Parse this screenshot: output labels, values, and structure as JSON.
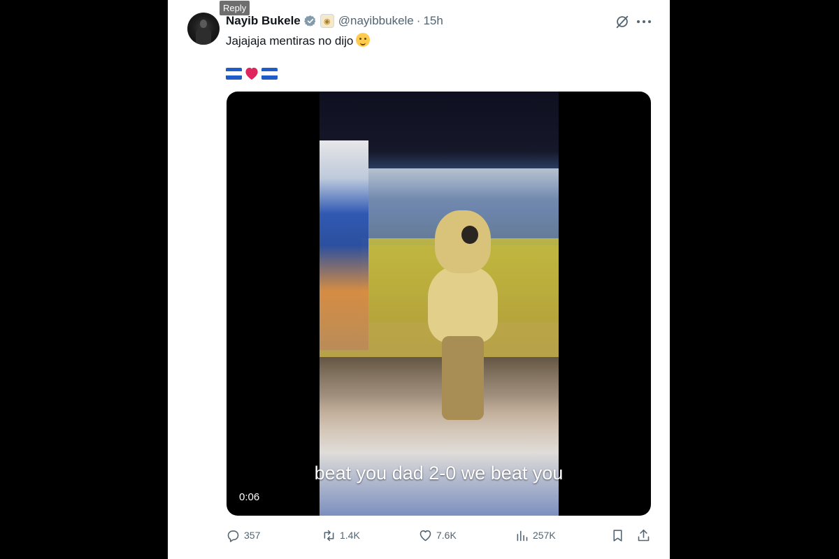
{
  "tooltip": {
    "label": "Reply"
  },
  "tweet": {
    "display_name": "Nayib Bukele",
    "handle": "@nayibbukele",
    "separator": "·",
    "time": "15h",
    "text": "Jajajaja mentiras no dijo",
    "emoji_icon": "crying-laughing-face",
    "flags_icons": [
      "el-salvador-flag",
      "red-heart",
      "el-salvador-flag"
    ],
    "verified_icon": "verified-badge-icon",
    "affiliate_icon": "affiliate-badge-icon"
  },
  "media": {
    "caption": "beat you dad 2-0 we beat you",
    "elapsed": "0:06"
  },
  "actions": {
    "replies": "357",
    "reposts": "1.4K",
    "likes": "7.6K",
    "views": "257K",
    "bookmark_icon": "bookmark-icon",
    "share_icon": "share-icon"
  },
  "colors": {
    "background": "#000000",
    "card": "#ffffff",
    "text_primary": "#0f1419",
    "text_secondary": "#536471",
    "verified": "#829aab",
    "heart": "#e0245e"
  }
}
